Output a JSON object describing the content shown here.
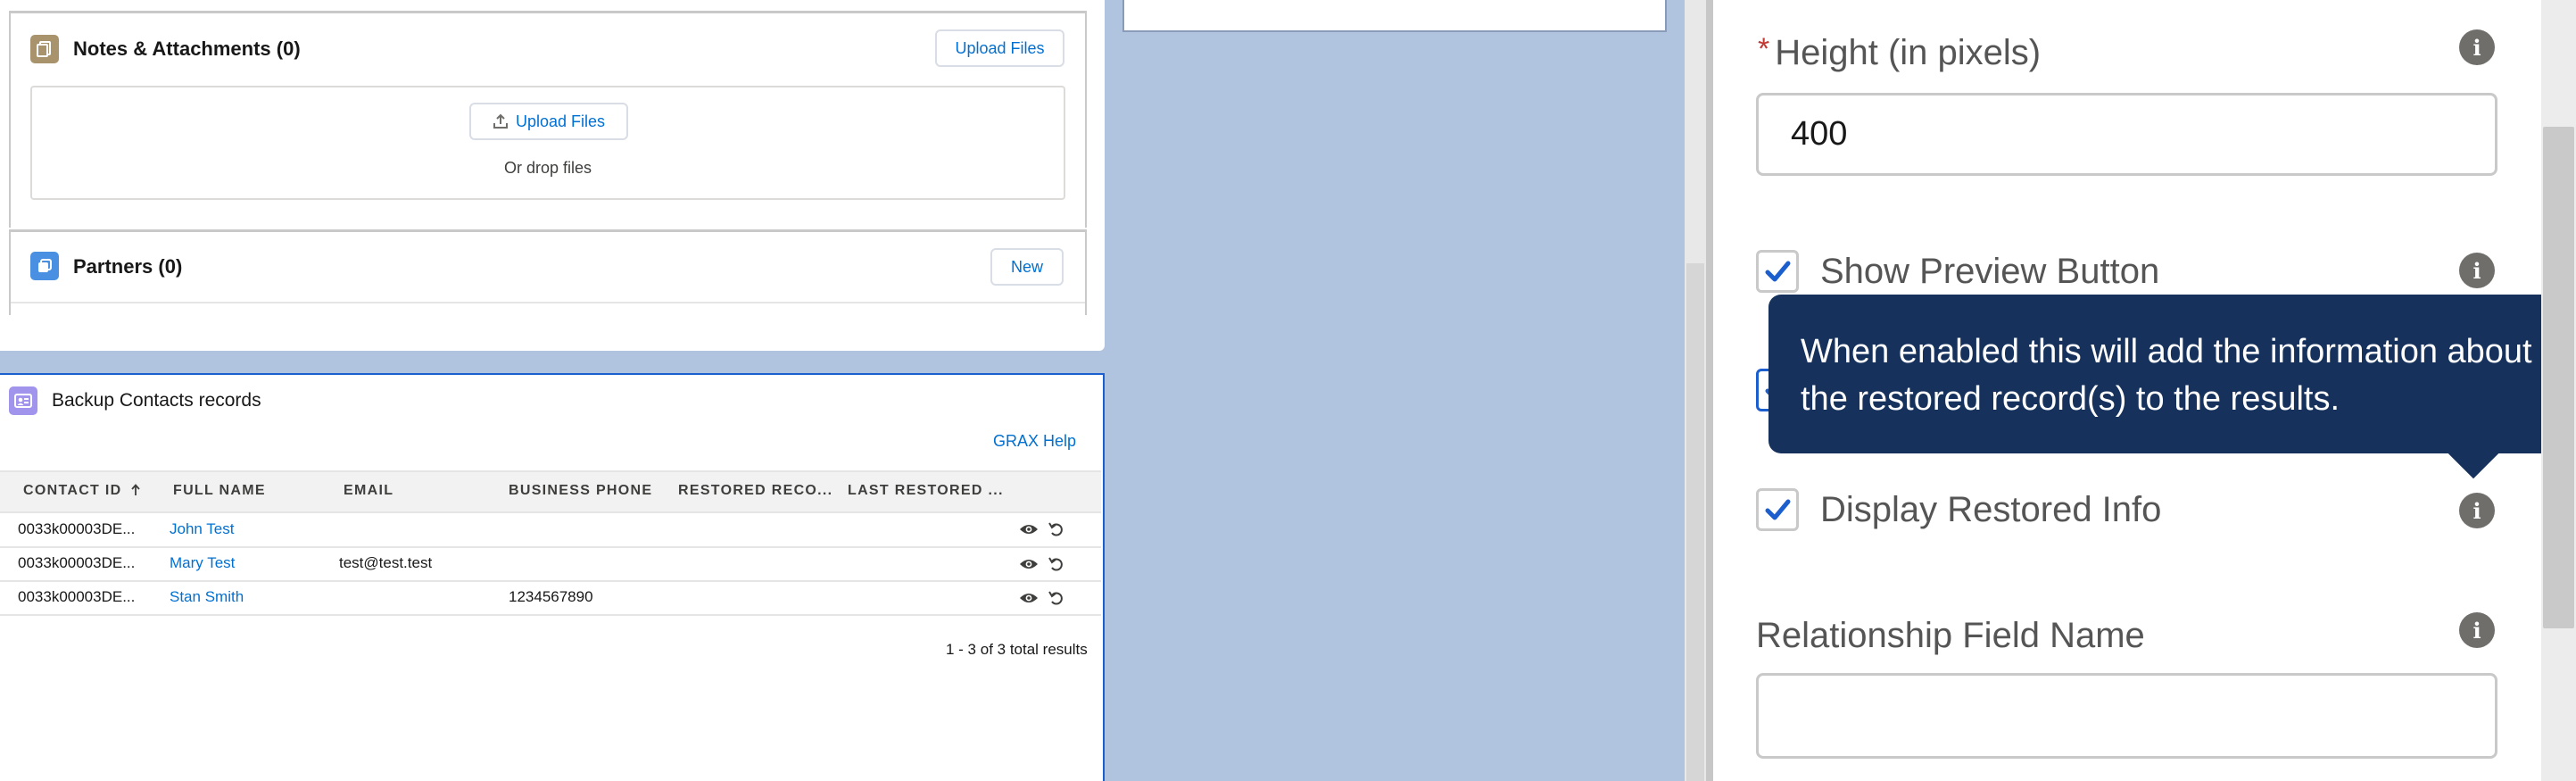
{
  "notes": {
    "title": "Notes & Attachments (0)",
    "header_button": "Upload Files",
    "upload_button": "Upload Files",
    "drop_text": "Or drop files"
  },
  "partners": {
    "title": "Partners (0)",
    "new_button": "New"
  },
  "table_card": {
    "title": "Backup Contacts records",
    "help_link": "GRAX Help",
    "columns": [
      "CONTACT ID",
      "FULL NAME",
      "EMAIL",
      "BUSINESS PHONE",
      "RESTORED RECO...",
      "LAST RESTORED ..."
    ],
    "rows": [
      {
        "contact_id": "0033k00003DE...",
        "full_name": "John Test",
        "email": "",
        "phone": ""
      },
      {
        "contact_id": "0033k00003DE...",
        "full_name": "Mary Test",
        "email": "test@test.test",
        "phone": ""
      },
      {
        "contact_id": "0033k00003DE...",
        "full_name": "Stan Smith",
        "email": "",
        "phone": "1234567890"
      }
    ],
    "footer": "1 - 3 of 3 total results",
    "sort": {
      "column": "CONTACT ID",
      "direction": "ascending"
    }
  },
  "panel": {
    "height_label": "Height (in pixels)",
    "required_marker": "*",
    "height_value": "400",
    "show_preview_label": "Show Preview Button",
    "show_preview_checked": true,
    "hidden_checkbox_checked": true,
    "display_restored_label": "Display Restored Info",
    "display_restored_checked": true,
    "relationship_label": "Relationship Field Name",
    "relationship_value": "",
    "info_glyph": "i",
    "tooltip": "When enabled this will add the information about the restored record(s) to the results."
  },
  "icons": [
    "notes-icon",
    "partners-icon",
    "contact-card-icon",
    "upload-icon",
    "sort-up-icon",
    "eye-icon",
    "undo-icon",
    "info-icon",
    "checkmark-icon"
  ],
  "colors": {
    "link": "#0070d2",
    "tooltip_bg": "#16325c",
    "canvas_bg": "#b0c3df",
    "selection_border": "#1b5fcf",
    "notes_icon": "#a8936d",
    "partners_icon": "#4a90e2",
    "contacts_icon": "#a094ed"
  }
}
